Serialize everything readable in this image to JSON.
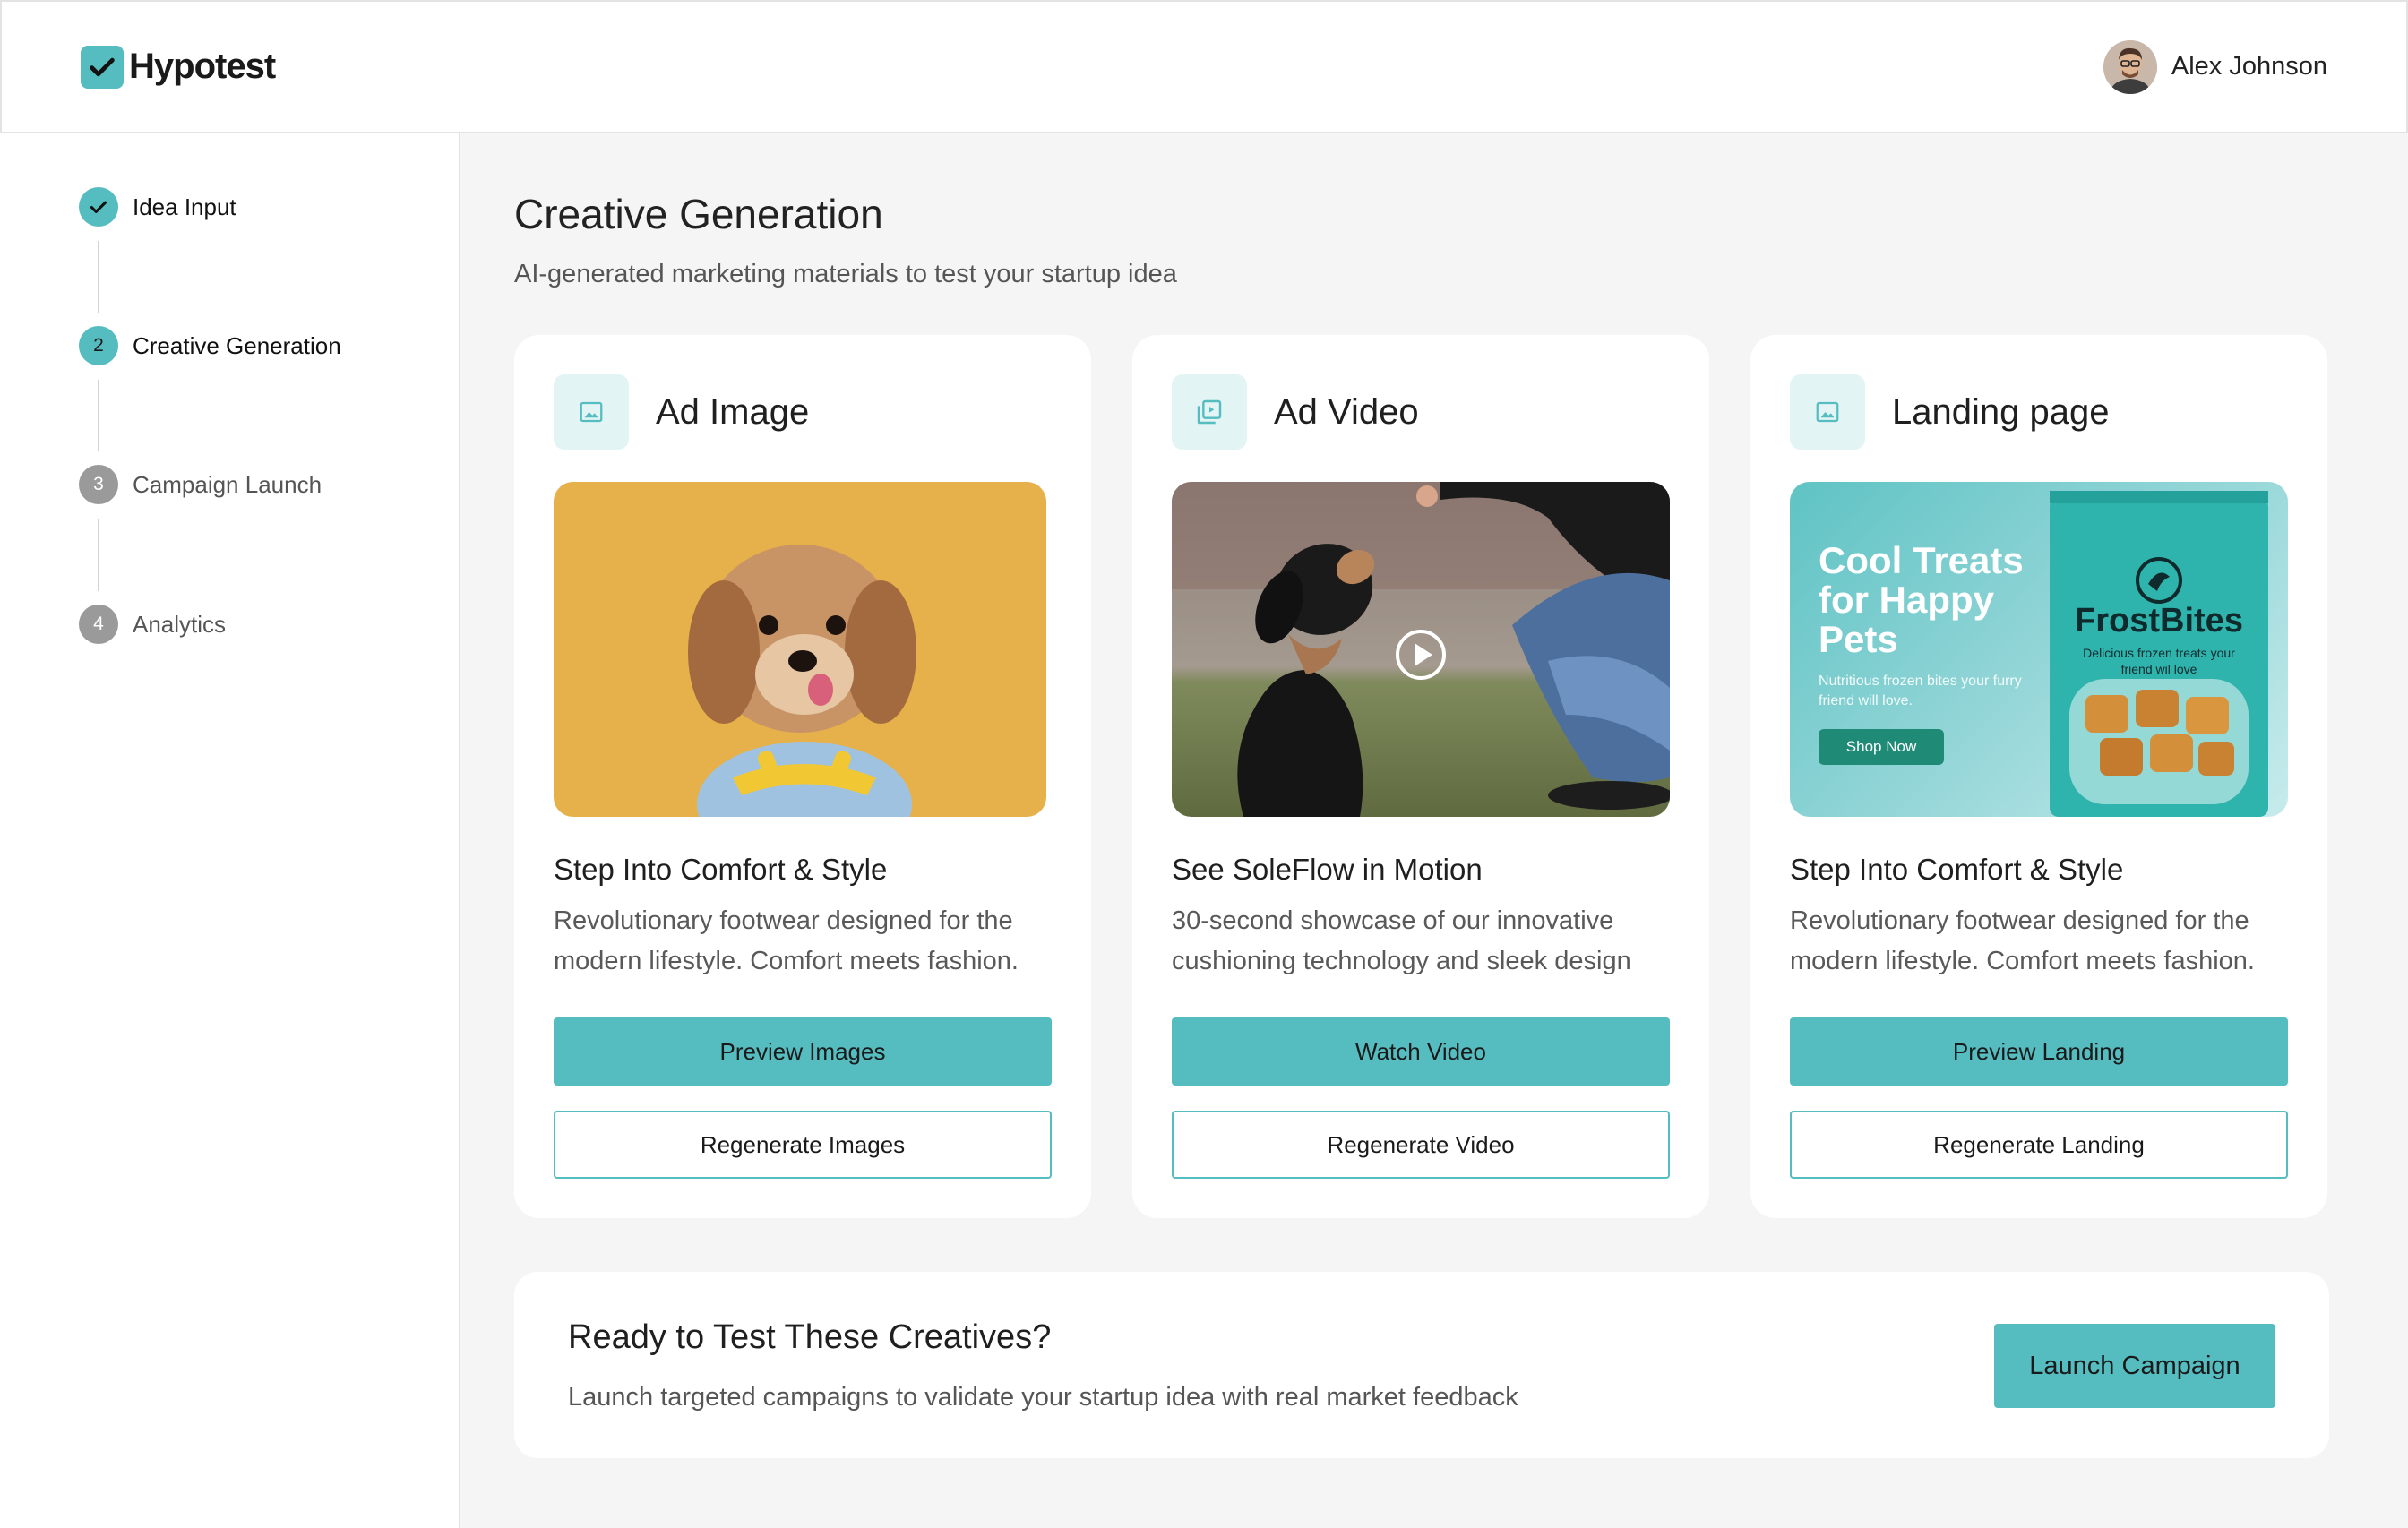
{
  "app": {
    "name": "Hypotest",
    "user_name": "Alex Johnson"
  },
  "steps": [
    {
      "number": "1",
      "label": "Idea Input",
      "state": "done"
    },
    {
      "number": "2",
      "label": "Creative Generation",
      "state": "active"
    },
    {
      "number": "3",
      "label": "Campaign Launch",
      "state": "pending"
    },
    {
      "number": "4",
      "label": "Analytics",
      "state": "pending"
    }
  ],
  "page": {
    "title": "Creative Generation",
    "subtitle": "AI-generated marketing materials to test your startup idea"
  },
  "cards": [
    {
      "title": "Ad Image",
      "icon": "image-icon",
      "media": "dog-on-yellow-image",
      "heading": "Step Into Comfort & Style",
      "description": "Revolutionary footwear designed for the modern lifestyle. Comfort meets fashion.",
      "primary_label": "Preview Images",
      "secondary_label": "Regenerate Images"
    },
    {
      "title": "Ad Video",
      "icon": "video-icon",
      "media": "puppy-video-thumbnail",
      "heading": "See SoleFlow in Motion",
      "description": "30-second showcase of our innovative cushioning technology and sleek design",
      "primary_label": "Watch Video",
      "secondary_label": "Regenerate Video"
    },
    {
      "title": "Landing page",
      "icon": "image-icon",
      "media": "landing-page-preview",
      "heading": "Step Into Comfort & Style",
      "description": "Revolutionary footwear designed for the modern lifestyle. Comfort meets fashion.",
      "primary_label": "Preview Landing",
      "secondary_label": "Regenerate Landing"
    }
  ],
  "landing_preview": {
    "headline": "Cool Treats for Happy Pets",
    "subtext": "Nutritious frozen bites your furry friend will love.",
    "button": "Shop Now",
    "brand": "FrostBites",
    "tagline": "Delicious frozen treats your friend wil love"
  },
  "cta": {
    "title": "Ready to Test These Creatives?",
    "description": "Launch targeted campaigns to validate your startup idea with real market feedback",
    "button_label": "Launch Campaign"
  },
  "colors": {
    "accent": "#55bcc0",
    "accent_light": "#e3f4f4",
    "background": "#f5f5f5",
    "pending_step": "#9a9a9a"
  }
}
